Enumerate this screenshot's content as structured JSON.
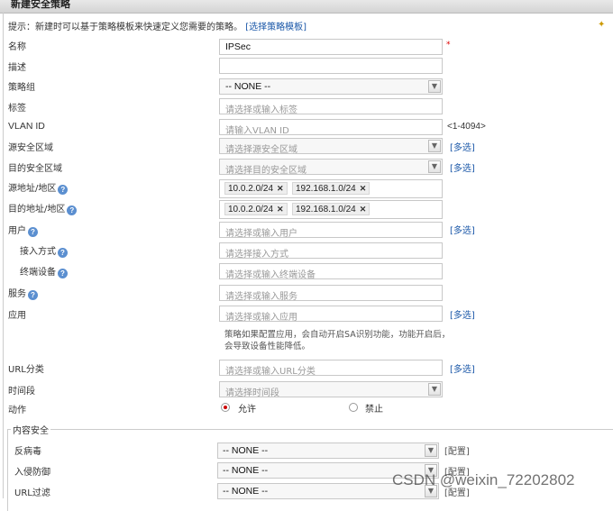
{
  "dialog_title": "新建安全策略",
  "hint": {
    "text": "提示：新建时可以基于策略模板来快速定义您需要的策略。",
    "link": "[选择策略模板]"
  },
  "fields": {
    "name": {
      "label": "名称",
      "value": "IPSec",
      "required": "*"
    },
    "desc": {
      "label": "描述",
      "value": ""
    },
    "group": {
      "label": "策略组",
      "value": "-- NONE --"
    },
    "tag": {
      "label": "标签",
      "placeholder": "请选择或输入标签"
    },
    "vlan": {
      "label": "VLAN ID",
      "placeholder": "请输入VLAN ID",
      "range": "<1-4094>"
    },
    "src_zone": {
      "label": "源安全区域",
      "placeholder": "请选择源安全区域",
      "multi": "[多选]"
    },
    "dst_zone": {
      "label": "目的安全区域",
      "placeholder": "请选择目的安全区域",
      "multi": "[多选]"
    },
    "src_addr": {
      "label": "源地址/地区",
      "tags": [
        "10.0.2.0/24",
        "192.168.1.0/24"
      ]
    },
    "dst_addr": {
      "label": "目的地址/地区",
      "tags": [
        "10.0.2.0/24",
        "192.168.1.0/24"
      ]
    },
    "user": {
      "label": "用户",
      "placeholder": "请选择或输入用户",
      "multi": "[多选]"
    },
    "access": {
      "label": "接入方式",
      "placeholder": "请选择接入方式"
    },
    "device": {
      "label": "终端设备",
      "placeholder": "请选择或输入终端设备"
    },
    "service": {
      "label": "服务",
      "placeholder": "请选择或输入服务"
    },
    "app": {
      "label": "应用",
      "placeholder": "请选择或输入应用",
      "multi": "[多选]",
      "note": "策略如果配置应用，会自动开启SA识别功能，功能开启后，会导致设备性能降低。"
    },
    "url": {
      "label": "URL分类",
      "placeholder": "请选择或输入URL分类",
      "multi": "[多选]"
    },
    "time": {
      "label": "时间段",
      "placeholder": "请选择时间段"
    },
    "action": {
      "label": "动作",
      "allow": "允许",
      "deny": "禁止",
      "selected": "允许"
    }
  },
  "content_security": {
    "legend": "内容安全",
    "rows": [
      {
        "label": "反病毒",
        "value": "-- NONE --",
        "config": "[配置]"
      },
      {
        "label": "入侵防御",
        "value": "-- NONE --",
        "config": "[配置]"
      },
      {
        "label": "URL过滤",
        "value": "-- NONE --",
        "config": "[配置]"
      }
    ]
  },
  "watermark": "CSDN @weixin_72202802",
  "icons": {
    "help": "question-icon",
    "dropdown": "chevron-down-icon",
    "remove": "close-icon",
    "top_right": "wand-icon"
  },
  "colors": {
    "link": "#1a57a8",
    "help": "#5b8fd0",
    "required": "#dd0000"
  }
}
